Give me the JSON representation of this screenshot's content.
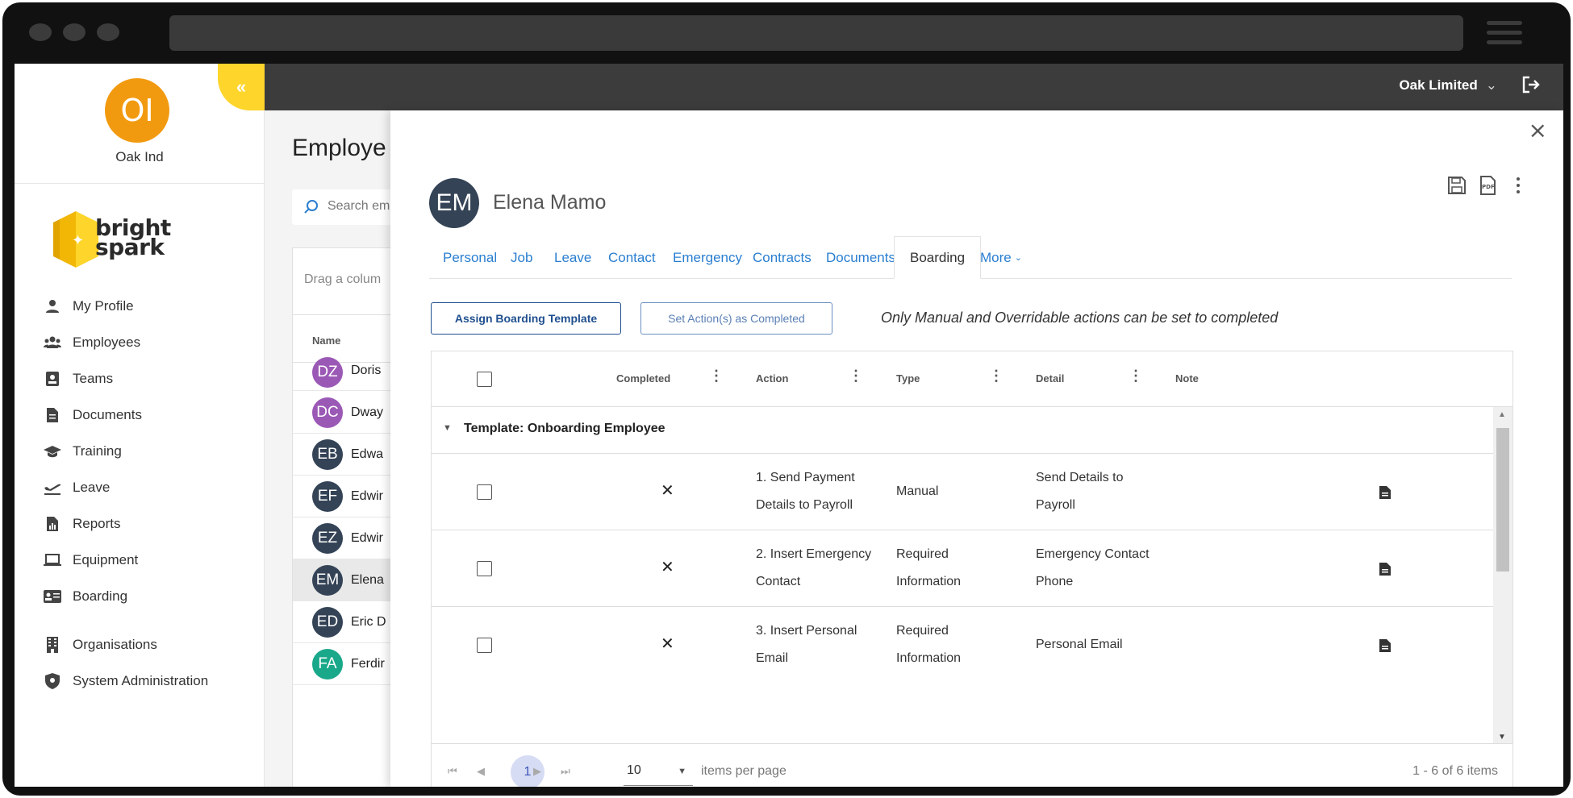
{
  "org": {
    "initials": "OI",
    "name": "Oak Ind"
  },
  "brand": {
    "logo_line1": "bright",
    "logo_line2": "spark",
    "accent": "#fdd52b"
  },
  "sidebar": {
    "items": [
      {
        "label": "My Profile",
        "icon": "person-icon"
      },
      {
        "label": "Employees",
        "icon": "people-icon"
      },
      {
        "label": "Teams",
        "icon": "teams-icon"
      },
      {
        "label": "Documents",
        "icon": "document-icon"
      },
      {
        "label": "Training",
        "icon": "graduation-cap-icon"
      },
      {
        "label": "Leave",
        "icon": "plane-icon"
      },
      {
        "label": "Reports",
        "icon": "report-icon"
      },
      {
        "label": "Equipment",
        "icon": "laptop-icon"
      },
      {
        "label": "Boarding",
        "icon": "id-card-icon"
      },
      {
        "label": "Organisations",
        "icon": "building-icon"
      },
      {
        "label": "System Administration",
        "icon": "shield-icon"
      }
    ]
  },
  "topbar": {
    "company": "Oak Limited"
  },
  "background_page": {
    "title": "Employe",
    "search_placeholder": "Search em",
    "drag_hint": "Drag a colum",
    "name_header": "Name",
    "rows": [
      {
        "initials": "DZ",
        "name": "Doris",
        "color": "#9b59b6"
      },
      {
        "initials": "DC",
        "name": "Dway",
        "color": "#9b59b6"
      },
      {
        "initials": "EB",
        "name": "Edwa",
        "color": "#344356"
      },
      {
        "initials": "EF",
        "name": "Edwir",
        "color": "#344356"
      },
      {
        "initials": "EZ",
        "name": "Edwir",
        "color": "#344356"
      },
      {
        "initials": "EM",
        "name": "Elena",
        "color": "#344356"
      },
      {
        "initials": "ED",
        "name": "Eric D",
        "color": "#344356"
      },
      {
        "initials": "FA",
        "name": "Ferdir",
        "color": "#1aa88a"
      }
    ]
  },
  "employee": {
    "initials": "EM",
    "name": "Elena Mamo"
  },
  "tabs": [
    "Personal",
    "Job",
    "Leave",
    "Contact",
    "Emergency",
    "Contracts",
    "Documents",
    "Boarding",
    "More"
  ],
  "active_tab": "Boarding",
  "actions": {
    "assign_label": "Assign Boarding Template",
    "complete_label": "Set Action(s) as Completed",
    "note": "Only Manual and Overridable actions can be set to completed"
  },
  "grid": {
    "columns": [
      "Completed",
      "Action",
      "Type",
      "Detail",
      "Note"
    ],
    "group_label": "Template: Onboarding Employee",
    "rows": [
      {
        "completed": "✕",
        "action_l1": "1. Send Payment",
        "action_l2": "Details to Payroll",
        "type_l1": "Manual",
        "type_l2": "",
        "detail_l1": "Send Details to",
        "detail_l2": "Payroll"
      },
      {
        "completed": "✕",
        "action_l1": "2. Insert Emergency",
        "action_l2": "Contact",
        "type_l1": "Required",
        "type_l2": "Information",
        "detail_l1": "Emergency Contact",
        "detail_l2": "Phone"
      },
      {
        "completed": "✕",
        "action_l1": "3. Insert Personal",
        "action_l2": "Email",
        "type_l1": "Required",
        "type_l2": "Information",
        "detail_l1": "Personal Email",
        "detail_l2": ""
      }
    ]
  },
  "pager": {
    "current_page": "1",
    "page_size": "10",
    "items_label": "items per page",
    "info": "1 - 6 of 6 items"
  }
}
